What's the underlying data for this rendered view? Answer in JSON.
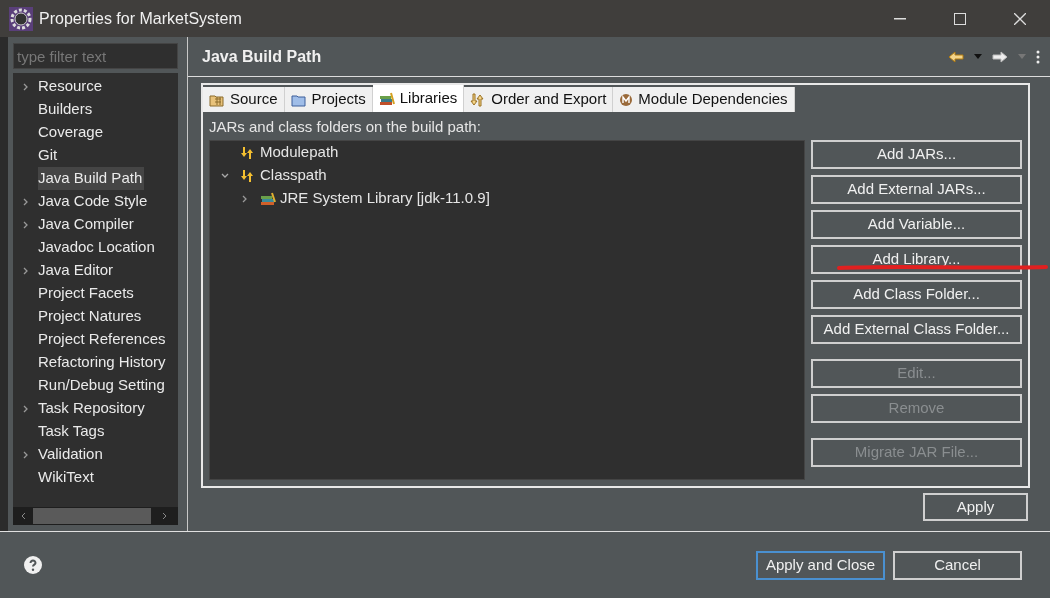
{
  "window": {
    "title": "Properties for MarketSystem"
  },
  "sidebar": {
    "filter": {
      "placeholder": "type filter text"
    },
    "items": [
      {
        "label": "Resource",
        "expandable": true,
        "selected": false
      },
      {
        "label": "Builders",
        "expandable": false,
        "selected": false
      },
      {
        "label": "Coverage",
        "expandable": false,
        "selected": false
      },
      {
        "label": "Git",
        "expandable": false,
        "selected": false
      },
      {
        "label": "Java Build Path",
        "expandable": false,
        "selected": true
      },
      {
        "label": "Java Code Style",
        "expandable": true,
        "selected": false
      },
      {
        "label": "Java Compiler",
        "expandable": true,
        "selected": false
      },
      {
        "label": "Javadoc Location",
        "expandable": false,
        "selected": false
      },
      {
        "label": "Java Editor",
        "expandable": true,
        "selected": false
      },
      {
        "label": "Project Facets",
        "expandable": false,
        "selected": false
      },
      {
        "label": "Project Natures",
        "expandable": false,
        "selected": false
      },
      {
        "label": "Project References",
        "expandable": false,
        "selected": false
      },
      {
        "label": "Refactoring History",
        "expandable": false,
        "selected": false
      },
      {
        "label": "Run/Debug Setting",
        "expandable": false,
        "selected": false
      },
      {
        "label": "Task Repository",
        "expandable": true,
        "selected": false
      },
      {
        "label": "Task Tags",
        "expandable": false,
        "selected": false
      },
      {
        "label": "Validation",
        "expandable": true,
        "selected": false
      },
      {
        "label": "WikiText",
        "expandable": false,
        "selected": false
      }
    ]
  },
  "page": {
    "title": "Java Build Path",
    "tabs": [
      {
        "label": "Source",
        "kind": "source",
        "selected": false
      },
      {
        "label": "Projects",
        "kind": "projects",
        "selected": false
      },
      {
        "label": "Libraries",
        "kind": "libraries",
        "selected": true
      },
      {
        "label": "Order and Export",
        "kind": "order",
        "selected": false
      },
      {
        "label": "Module Dependencies",
        "kind": "module",
        "selected": false
      }
    ],
    "description": "JARs and class folders on the build path:",
    "tree": [
      {
        "label": "Modulepath",
        "kind": "path"
      },
      {
        "label": "Classpath",
        "kind": "path",
        "expanded": true,
        "children": [
          {
            "label": "JRE System Library [jdk-11.0.9]",
            "kind": "library",
            "expanded": false
          }
        ]
      }
    ],
    "buttons": [
      {
        "label": "Add JARs...",
        "disabled": false
      },
      {
        "label": "Add External JARs...",
        "disabled": false
      },
      {
        "label": "Add Variable...",
        "disabled": false
      },
      {
        "label": "Add Library...",
        "disabled": false
      },
      {
        "label": "Add Class Folder...",
        "disabled": false
      },
      {
        "label": "Add External Class Folder...",
        "disabled": false
      },
      {
        "label": "Edit...",
        "disabled": true
      },
      {
        "label": "Remove",
        "disabled": true
      },
      {
        "label": "Migrate JAR File...",
        "disabled": true
      }
    ],
    "apply": "Apply"
  },
  "footer": {
    "buttons": [
      {
        "label": "Apply and Close",
        "default": true
      },
      {
        "label": "Cancel",
        "default": false
      }
    ]
  }
}
